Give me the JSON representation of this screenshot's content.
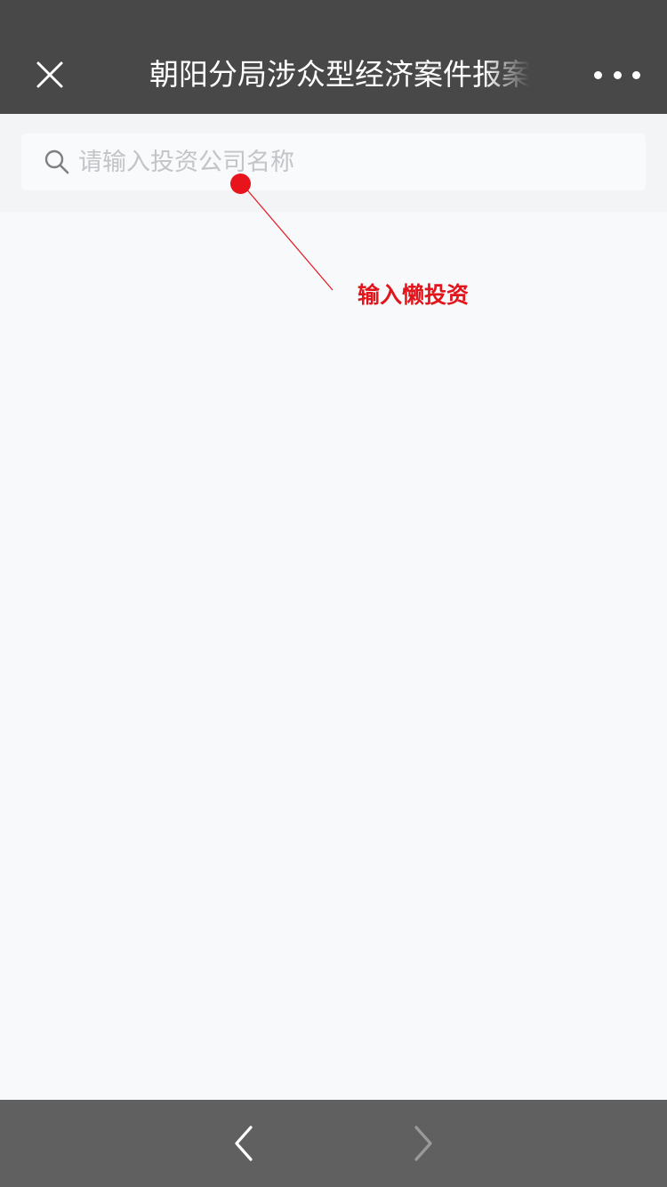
{
  "header": {
    "title": "朝阳分局涉众型经济案件报案",
    "close_icon": "close-icon",
    "more_icon": "more-icon"
  },
  "search": {
    "placeholder": "请输入投资公司名称",
    "value": "",
    "icon": "search-icon"
  },
  "annotation": {
    "text": "输入懒投资",
    "color": "#e0161c"
  },
  "footer": {
    "back_icon": "chevron-left-icon",
    "forward_icon": "chevron-right-icon"
  },
  "colors": {
    "header_bg": "#484848",
    "page_bg": "#f8f9fb",
    "footer_bg": "#606060"
  }
}
